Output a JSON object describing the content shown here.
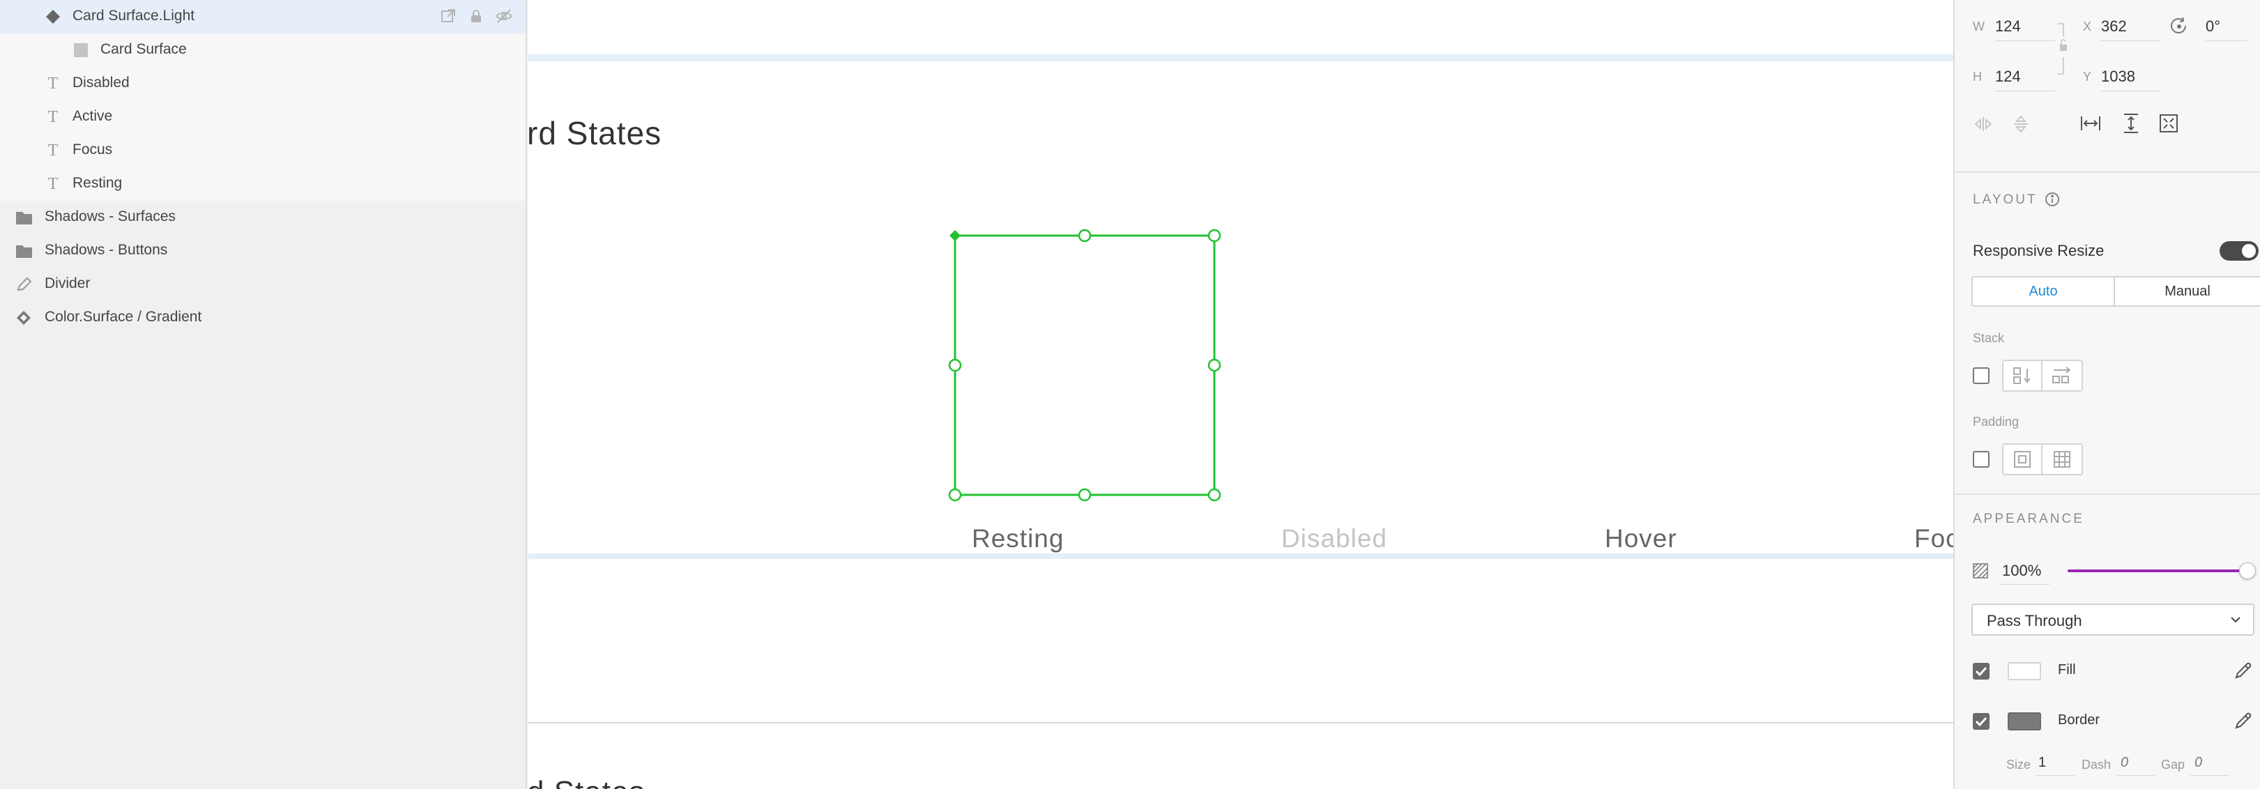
{
  "layers": {
    "items": [
      {
        "label": "Card Surface.Light",
        "icon": "component-icon",
        "selected": true
      },
      {
        "label": "Card Surface",
        "icon": "rectangle-icon"
      },
      {
        "label": "Disabled",
        "icon": "text-icon"
      },
      {
        "label": "Active",
        "icon": "text-icon"
      },
      {
        "label": "Focus",
        "icon": "text-icon"
      },
      {
        "label": "Resting",
        "icon": "text-icon"
      },
      {
        "label": "Shadows - Surfaces",
        "icon": "folder-icon"
      },
      {
        "label": "Shadows - Buttons",
        "icon": "folder-icon"
      },
      {
        "label": "Divider",
        "icon": "pen-icon"
      },
      {
        "label": "Color.Surface / Gradient",
        "icon": "component-icon"
      }
    ]
  },
  "canvas": {
    "section_title": "rd States",
    "section_title_2": "d States",
    "states": [
      "Resting",
      "Disabled",
      "Hover",
      "Foc"
    ],
    "selection_color": "#22c232"
  },
  "inspector": {
    "w_label": "W",
    "w_value": "124",
    "x_label": "X",
    "x_value": "362",
    "h_label": "H",
    "h_value": "124",
    "y_label": "Y",
    "y_value": "1038",
    "rotation_value": "0°",
    "layout_title": "LAYOUT",
    "responsive_label": "Responsive Resize",
    "responsive_on": true,
    "auto_label": "Auto",
    "manual_label": "Manual",
    "stack_label": "Stack",
    "padding_label": "Padding",
    "appearance_title": "APPEARANCE",
    "opacity_value": "100%",
    "opacity_fraction": 1.0,
    "blend_mode": "Pass Through",
    "fill_label": "Fill",
    "fill_color": "#ffffff",
    "border_label": "Border",
    "border_color": "#7a7a7a",
    "size_label": "Size",
    "size_value": "1",
    "dash_label": "Dash",
    "dash_value": "0",
    "gap_label": "Gap",
    "gap_value": "0",
    "accent_color": "#1a8cd8",
    "slider_color": "#9b27b0"
  }
}
